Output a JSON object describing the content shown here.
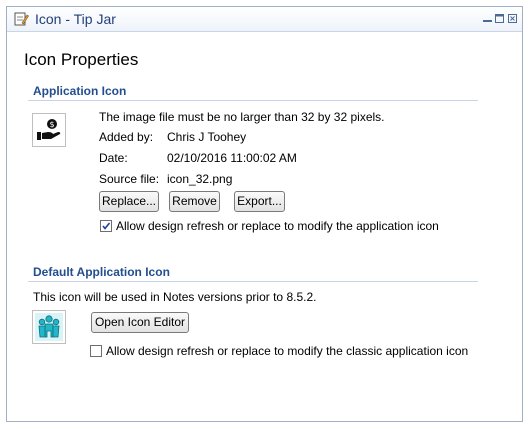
{
  "window": {
    "title": "Icon - Tip Jar"
  },
  "page": {
    "title": "Icon Properties"
  },
  "application_icon": {
    "header": "Application Icon",
    "size_note": "The image file must be no larger than 32 by 32 pixels.",
    "added_by_label": "Added by:",
    "added_by_value": "Chris J Toohey",
    "date_label": "Date:",
    "date_value": "02/10/2016 11:00:02 AM",
    "source_label": "Source file:",
    "source_value": "icon_32.png",
    "replace_label": "Replace...",
    "remove_label": "Remove",
    "export_label": "Export...",
    "allow_label": "Allow design refresh or replace to modify the application icon",
    "allow_checked": true
  },
  "default_icon": {
    "header": "Default Application Icon",
    "note": "This icon will be used in Notes versions prior to 8.5.2.",
    "editor_label": "Open Icon Editor",
    "allow_label": "Allow design refresh or replace to modify the classic application icon",
    "allow_checked": false
  },
  "colors": {
    "title_text": "#1f3f7a",
    "section_header": "#234e8f",
    "default_icon_fill": "#21b6c8"
  },
  "icons": {
    "title": "edit-document-icon",
    "app_icon": "hand-holding-coin-icon",
    "default_icon": "people-group-icon"
  }
}
